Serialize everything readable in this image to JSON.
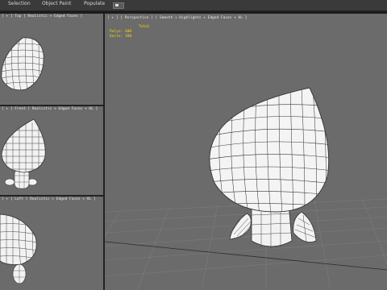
{
  "menu": {
    "items": [
      "Selection",
      "Object Paint",
      "Populate"
    ]
  },
  "viewports": {
    "top_left": {
      "label": "[ + ] Top [ Realistic + Edged Faces ] "
    },
    "mid_left": {
      "label": "[ + ] Front [ Realistic + Edged Faces + HL ] "
    },
    "bottom_left": {
      "label": "[ + ] Left [ Realistic + Edged Faces + HL ] "
    },
    "main": {
      "label": "[ + ] [ Perspective ] [ Smooth + Highlights + Edged Faces + HL ]",
      "stats": {
        "title": "Total",
        "polys_label": "Polys:",
        "polys_value": "400",
        "verts_label": "Verts:",
        "verts_value": "398"
      }
    }
  },
  "colors": {
    "viewport_bg": "#6b6b6b",
    "stats_text": "#ffd700",
    "mesh_fill": "#f2f2f2",
    "mesh_wire": "#333333"
  }
}
